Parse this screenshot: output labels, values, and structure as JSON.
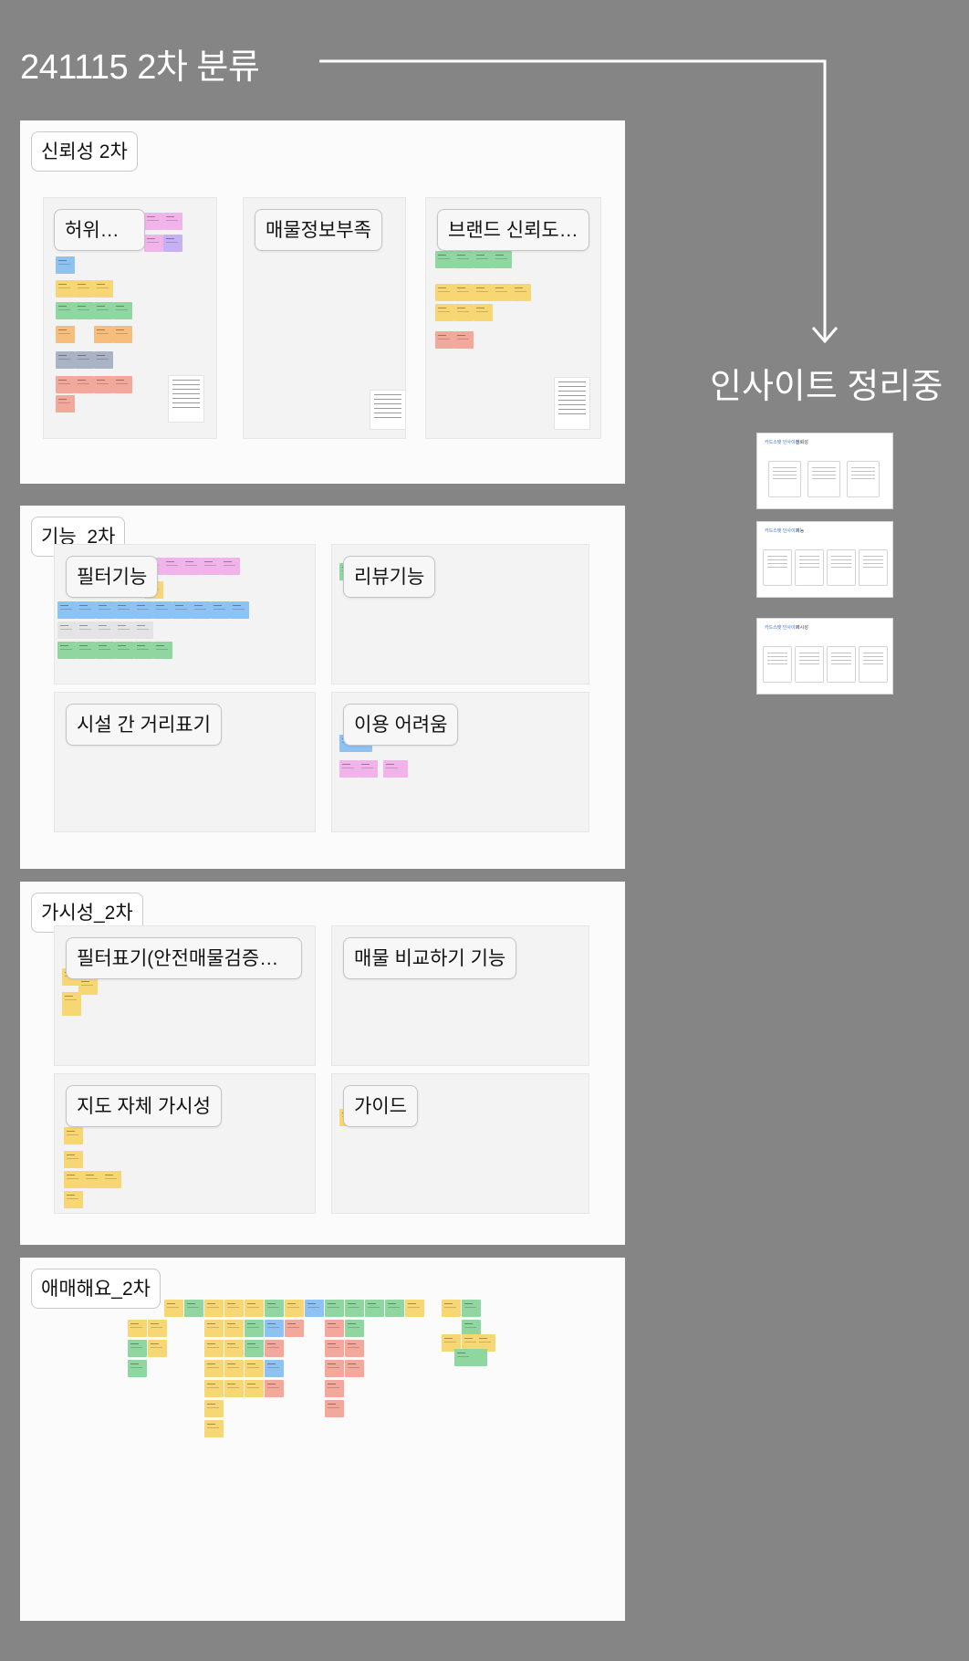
{
  "canvas": {
    "title": "241115 2차 분류",
    "insight_title": "인사이트 정리중"
  },
  "colors": {
    "background": "#858585",
    "sticky_yellow": "#f7d774",
    "sticky_green": "#8fd6a0",
    "sticky_blue": "#8ec2f2",
    "sticky_pink": "#f0b4ea",
    "sticky_purple": "#c7b0f2",
    "sticky_orange": "#f6bd7c",
    "sticky_red": "#f2a89a",
    "sticky_gray": "#a9b3c4"
  },
  "sections": [
    {
      "label": "신뢰성 2차",
      "groups": [
        {
          "label": "허위매물"
        },
        {
          "label": "매물정보부족"
        },
        {
          "label": "브랜드 신뢰도 ..."
        }
      ]
    },
    {
      "label": "기능_2차",
      "groups": [
        {
          "label": "필터기능"
        },
        {
          "label": "리뷰기능"
        },
        {
          "label": "시설 간 거리표기"
        },
        {
          "label": "이용 어려움"
        }
      ]
    },
    {
      "label": "가시성_2차",
      "groups": [
        {
          "label": "필터표기(안전매물검증시..."
        },
        {
          "label": "매물 비교하기 기능"
        },
        {
          "label": "지도 자체 가시성"
        },
        {
          "label": "가이드"
        }
      ]
    },
    {
      "label": "애매해요_2차",
      "groups": []
    }
  ],
  "insight_thumbnails": [
    {
      "title": "카드스탯 인사이트",
      "subtitle": "신뢰성",
      "cards": 3
    },
    {
      "title": "카드스탯 인사이트",
      "subtitle": "기능",
      "cards": 4
    },
    {
      "title": "카드스탯 인사이트",
      "subtitle": "가시성",
      "cards": 4
    }
  ]
}
